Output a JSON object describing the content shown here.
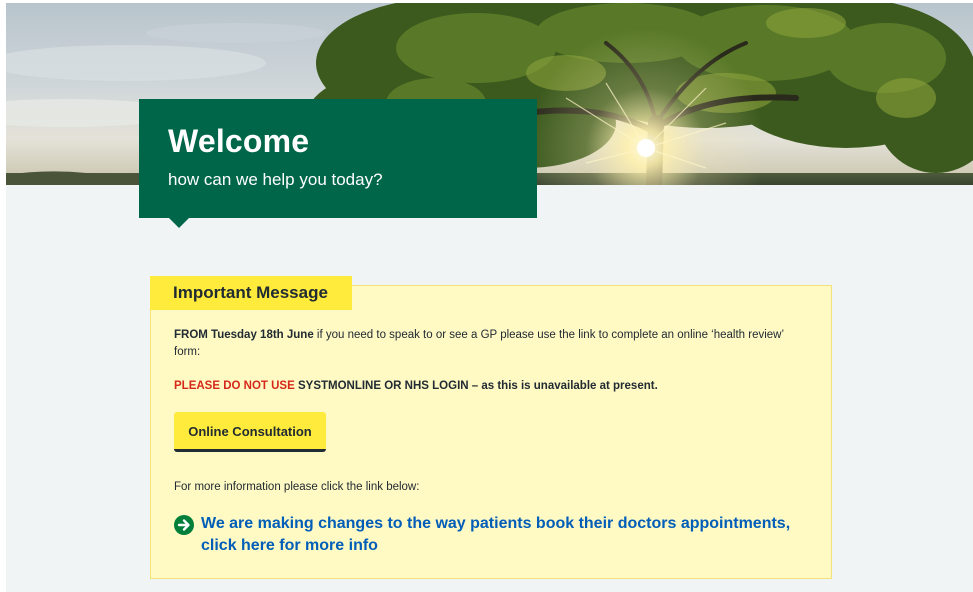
{
  "hero": {
    "image": "tree-landscape-sunset"
  },
  "welcome": {
    "title": "Welcome",
    "subtitle": "how can we help you today?"
  },
  "important_message": {
    "heading": "Important Message",
    "line1_bold": "FROM Tuesday 18th June",
    "line1_text": " if you need to speak to or see a GP please use the link to complete an online ‘health review’",
    "line1_text2": "form:",
    "warning_red": "PLEASE DO NOT USE",
    "warning_bold": " SYSTMONLINE OR NHS LOGIN",
    "warning_rest": " – as this is unavailable at present.",
    "button_label": "Online Consultation",
    "more_info_text": "For more information please click the link below:",
    "link_line1": "We are making changes to the way patients book their doctors appointments,",
    "link_line2": "click here for more info"
  },
  "colors": {
    "nhs_green": "#00664a",
    "yellow": "#ffeb3b",
    "panel_bg": "#fff9c4",
    "link_blue": "#005eb8",
    "warning_red": "#d5281b"
  }
}
